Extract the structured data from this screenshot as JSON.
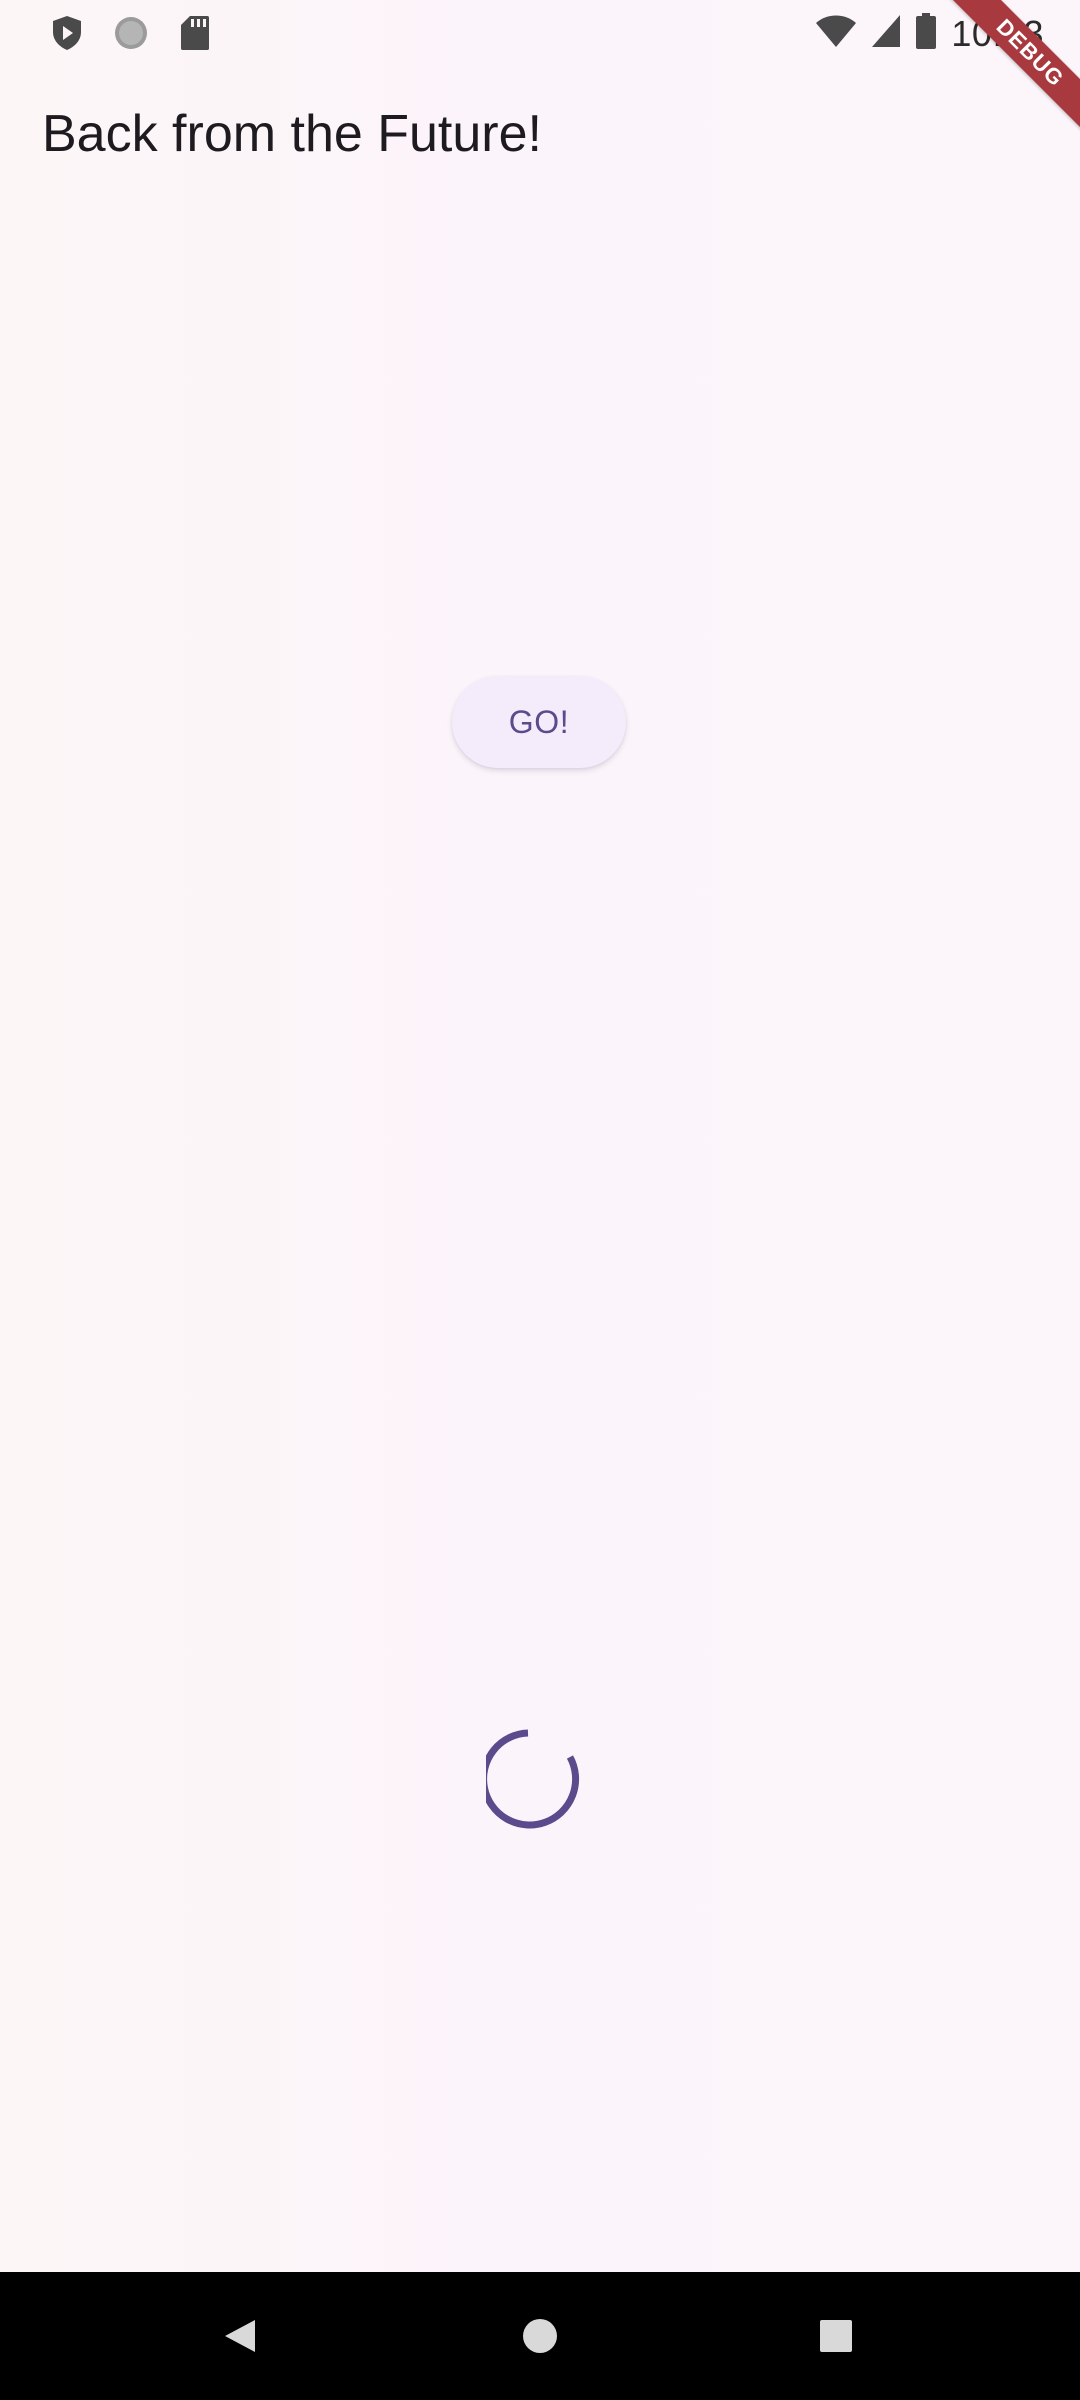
{
  "status_bar": {
    "time": "10:33",
    "left_icons": [
      "shield-play-icon",
      "circle-icon",
      "sd-card-icon"
    ],
    "right_icons": [
      "wifi-icon",
      "signal-icon",
      "battery-icon"
    ]
  },
  "app_bar": {
    "title": "Back from the Future!"
  },
  "main": {
    "go_button_label": "GO!",
    "loading_indicator": "circular-progress-icon"
  },
  "debug_banner": {
    "label": "DEBUG",
    "color": "#a83a3f"
  },
  "navigation_bar": {
    "buttons": [
      "back-icon",
      "home-icon",
      "recents-icon"
    ]
  },
  "colors": {
    "accent": "#5b4a8c",
    "button_background": "#f4ecfa",
    "background": "#fcf6f9"
  }
}
